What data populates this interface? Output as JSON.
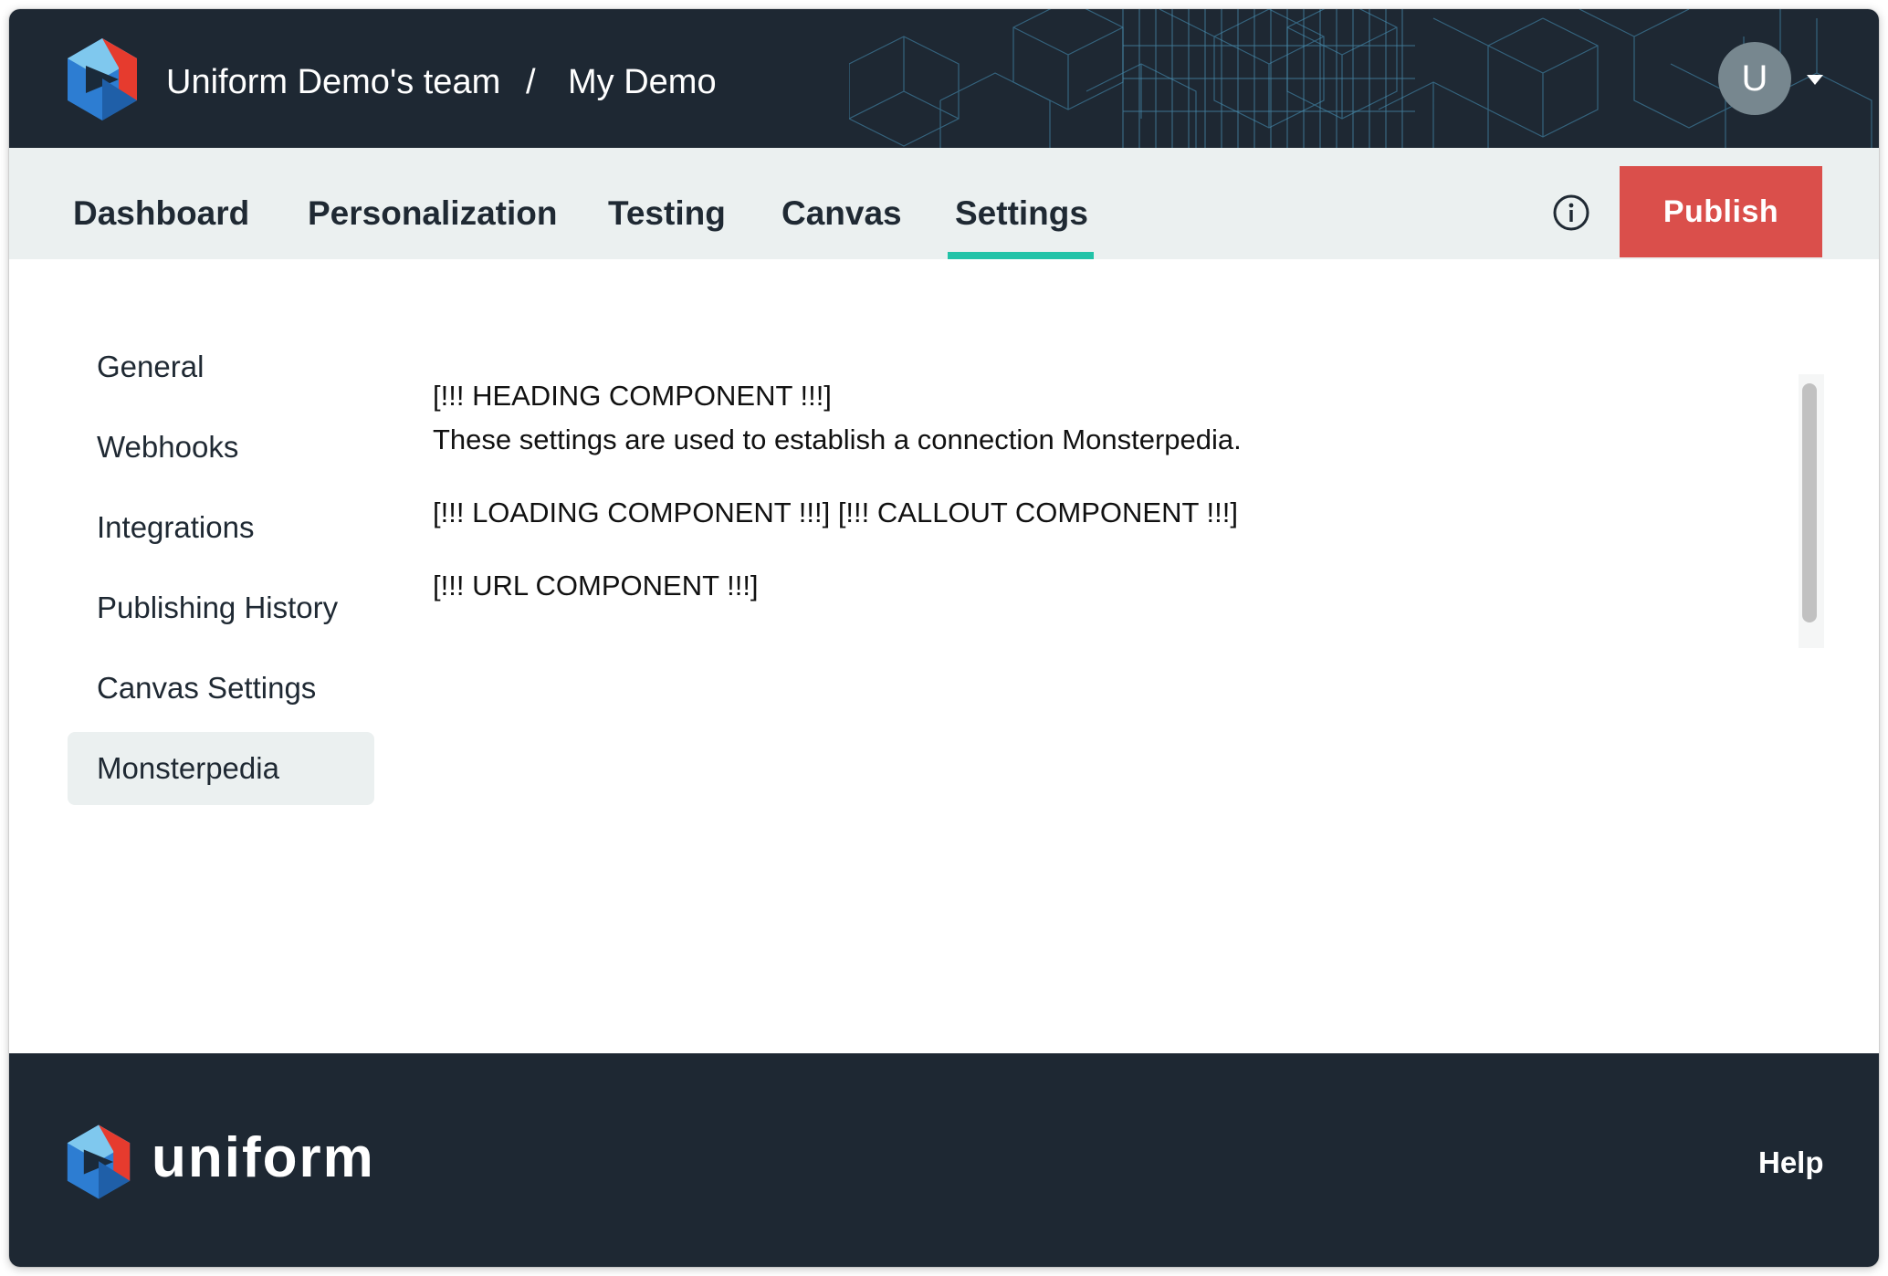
{
  "header": {
    "team": "Uniform Demo's team",
    "separator": "/",
    "project": "My Demo",
    "avatar_initial": "U"
  },
  "nav": {
    "tabs": [
      {
        "label": "Dashboard",
        "active": false
      },
      {
        "label": "Personalization",
        "active": false
      },
      {
        "label": "Testing",
        "active": false
      },
      {
        "label": "Canvas",
        "active": false
      },
      {
        "label": "Settings",
        "active": true
      }
    ],
    "publish_label": "Publish",
    "accent_color": "#22c3a8",
    "publish_color": "#da4f4b"
  },
  "sidebar": {
    "items": [
      {
        "label": "General",
        "active": false
      },
      {
        "label": "Webhooks",
        "active": false
      },
      {
        "label": "Integrations",
        "active": false
      },
      {
        "label": "Publishing History",
        "active": false
      },
      {
        "label": "Canvas Settings",
        "active": false
      },
      {
        "label": "Monsterpedia",
        "active": true
      }
    ]
  },
  "content": {
    "heading_placeholder": "[!!! HEADING COMPONENT !!!]",
    "description": "These settings are used to establish a connection Monsterpedia.",
    "components_line": "[!!! LOADING COMPONENT !!!] [!!! CALLOUT COMPONENT !!!]",
    "url_placeholder": "[!!! URL COMPONENT !!!]"
  },
  "footer": {
    "brand": "uniform",
    "help_label": "Help"
  },
  "icons": {
    "logo": "uniform-logo-icon",
    "info": "info-icon",
    "caret": "caret-down-icon"
  }
}
